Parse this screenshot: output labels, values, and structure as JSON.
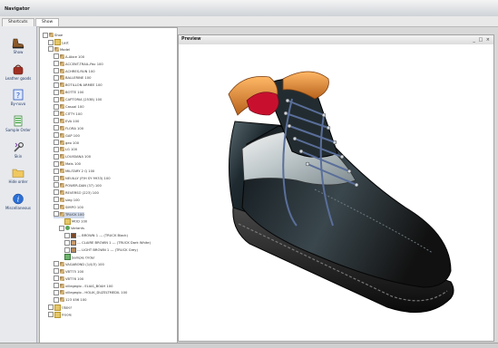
{
  "window": {
    "title": "Navigator"
  },
  "tabs": [
    {
      "label": "Shortcuts"
    },
    {
      "label": "Show"
    }
  ],
  "sidebar": {
    "items": [
      {
        "label": "Show",
        "icon": "shoe-icon"
      },
      {
        "label": "Leather goods",
        "icon": "bag-icon"
      },
      {
        "label": "By-nuvo",
        "icon": "help-icon"
      },
      {
        "label": "Sample Order",
        "icon": "document-icon"
      },
      {
        "label": "Skin",
        "icon": "wrench-icon"
      },
      {
        "label": "Hide order",
        "icon": "folder-icon"
      },
      {
        "label": "Miscellaneous",
        "icon": "info-icon"
      }
    ]
  },
  "tree": {
    "rows": [
      {
        "label": "Shoe",
        "indent": 0,
        "box": "-",
        "icon": "model"
      },
      {
        "label": "Last",
        "indent": 1,
        "box": "+",
        "icon": "folder"
      },
      {
        "label": "Model",
        "indent": 1,
        "box": "-",
        "icon": "model"
      },
      {
        "label": "A-Abce 100",
        "indent": 2,
        "box": "+",
        "icon": "model"
      },
      {
        "label": "ACCENT-TRAIL-Pac 100",
        "indent": 2,
        "box": "+",
        "icon": "model"
      },
      {
        "label": "ACHRES-RUN 100",
        "indent": 2,
        "box": "+",
        "icon": "model"
      },
      {
        "label": "BALLERINE 100",
        "indent": 2,
        "box": "+",
        "icon": "model"
      },
      {
        "label": "BOTILLON ARMEE 100",
        "indent": 2,
        "box": "+",
        "icon": "model"
      },
      {
        "label": "BOTTE 100",
        "indent": 2,
        "box": "+",
        "icon": "model"
      },
      {
        "label": "CAPTORIA (2538) 100",
        "indent": 2,
        "box": "+",
        "icon": "model"
      },
      {
        "label": "Casual 100",
        "indent": 2,
        "box": "+",
        "icon": "model"
      },
      {
        "label": "CITTY 100",
        "indent": 2,
        "box": "+",
        "icon": "model"
      },
      {
        "label": "EVA 100",
        "indent": 2,
        "box": "+",
        "icon": "model"
      },
      {
        "label": "FLORA 100",
        "indent": 2,
        "box": "+",
        "icon": "model"
      },
      {
        "label": "GAP 100",
        "indent": 2,
        "box": "+",
        "icon": "model"
      },
      {
        "label": "geo 100",
        "indent": 2,
        "box": "+",
        "icon": "model"
      },
      {
        "label": "LG 100",
        "indent": 2,
        "box": "+",
        "icon": "model"
      },
      {
        "label": "LOUISIANA 100",
        "indent": 2,
        "box": "+",
        "icon": "model"
      },
      {
        "label": "Mats 100",
        "indent": 2,
        "box": "+",
        "icon": "model"
      },
      {
        "label": "MILITARY 2 Q 100",
        "indent": 2,
        "box": "+",
        "icon": "model"
      },
      {
        "label": "NEUILLY (P/H SY 9933) 100",
        "indent": 2,
        "box": "+",
        "icon": "model"
      },
      {
        "label": "POWER-DAN (37) 100",
        "indent": 2,
        "box": "+",
        "icon": "model"
      },
      {
        "label": "REVERSO (223) 100",
        "indent": 2,
        "box": "+",
        "icon": "model"
      },
      {
        "label": "sieg 100",
        "indent": 2,
        "box": "+",
        "icon": "model"
      },
      {
        "label": "SIMPO 100",
        "indent": 2,
        "box": "+",
        "icon": "model"
      },
      {
        "label": "TRUCK 100",
        "indent": 2,
        "box": "-",
        "icon": "model",
        "selected": true
      },
      {
        "label": "MOD 100",
        "indent": 3,
        "box": "",
        "icon": "folder"
      },
      {
        "label": "Variants",
        "indent": 3,
        "box": "-",
        "icon": "var"
      },
      {
        "label": "--- BROWN 1 ---   (TRUCK Black)",
        "indent": 4,
        "box": "+",
        "icon": "color",
        "color": "#7a4a2a"
      },
      {
        "label": "--- CLAIRE BROWN 1 ---   (TRUCK Dark White)",
        "indent": 4,
        "box": "+",
        "icon": "color",
        "color": "#c89b6a"
      },
      {
        "label": "--- LIGHT BROWN 1 ---   (TRUCK Grey)",
        "indent": 4,
        "box": "+",
        "icon": "color",
        "color": "#b58b5f"
      },
      {
        "label": "Sample Order",
        "indent": 3,
        "box": "",
        "icon": "sample"
      },
      {
        "label": "VAGABOND (1/4/3) 100",
        "indent": 2,
        "box": "+",
        "icon": "model"
      },
      {
        "label": "VBT75 100",
        "indent": 2,
        "box": "+",
        "icon": "model"
      },
      {
        "label": "VBT76 100",
        "indent": 2,
        "box": "+",
        "icon": "model"
      },
      {
        "label": "villegeglo - ELIAS_BOAH 100",
        "indent": 2,
        "box": "+",
        "icon": "model"
      },
      {
        "label": "villegeglo - HOLIK_DUZELTMEDIL 100",
        "indent": 2,
        "box": "+",
        "icon": "model"
      },
      {
        "label": "123 456 100",
        "indent": 2,
        "box": "+",
        "icon": "model"
      },
      {
        "label": "Upper",
        "indent": 1,
        "box": "+",
        "icon": "folder"
      },
      {
        "label": "Insole",
        "indent": 1,
        "box": "+",
        "icon": "folder"
      }
    ]
  },
  "preview": {
    "title": "Preview",
    "controls": "_ □ ×"
  },
  "colors": {
    "accent": "#233a66",
    "leather": "#1e262a",
    "collar": "#e08a2e",
    "lining": "#c8102e"
  }
}
